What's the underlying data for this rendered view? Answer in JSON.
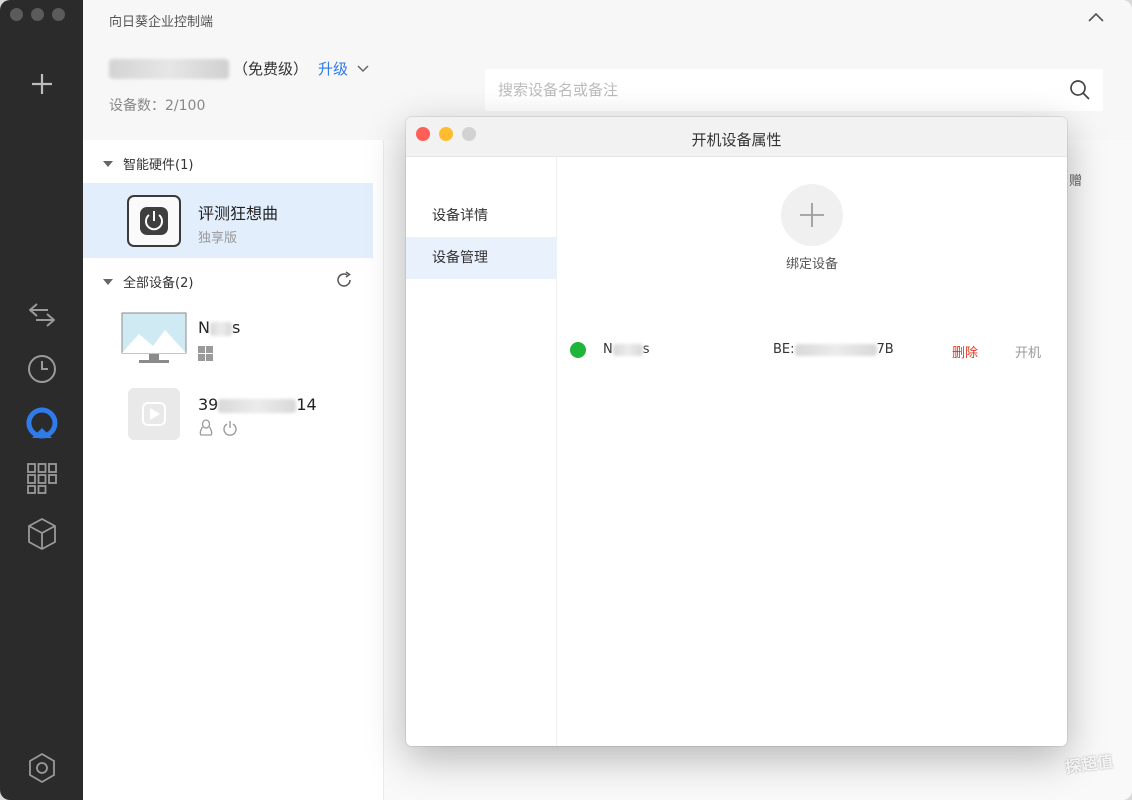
{
  "app": {
    "title": "向日葵企业控制端",
    "account_level": "（免费级）",
    "upgrade_label": "升级",
    "device_count": "设备数：2/100"
  },
  "search": {
    "placeholder": "搜索设备名或备注"
  },
  "groups": [
    {
      "label": "智能硬件(1)"
    },
    {
      "label": "全部设备(2)"
    }
  ],
  "devices": [
    {
      "name": "评测狂想曲",
      "sub": "独享版"
    },
    {
      "name_prefix": "N",
      "name_suffix": "s"
    },
    {
      "name_prefix": "39",
      "name_suffix": "14"
    }
  ],
  "right_panel": {
    "gift_text": "赠"
  },
  "modal": {
    "title": "开机设备属性",
    "sidebar": [
      "设备详情",
      "设备管理"
    ],
    "active_tab": "设备管理",
    "bind_label": "绑定设备",
    "row": {
      "name_prefix": "N",
      "name_suffix": "s",
      "mac_prefix": "BE:",
      "mac_suffix": "7B",
      "delete_label": "删除",
      "power_on_label": "开机",
      "status_color": "#1fb53a"
    }
  },
  "colors": {
    "accent": "#2f7bea",
    "danger": "#e5331c",
    "rail": "#2b2b2b",
    "selected": "#e3eefc"
  },
  "watermark": "探超值"
}
